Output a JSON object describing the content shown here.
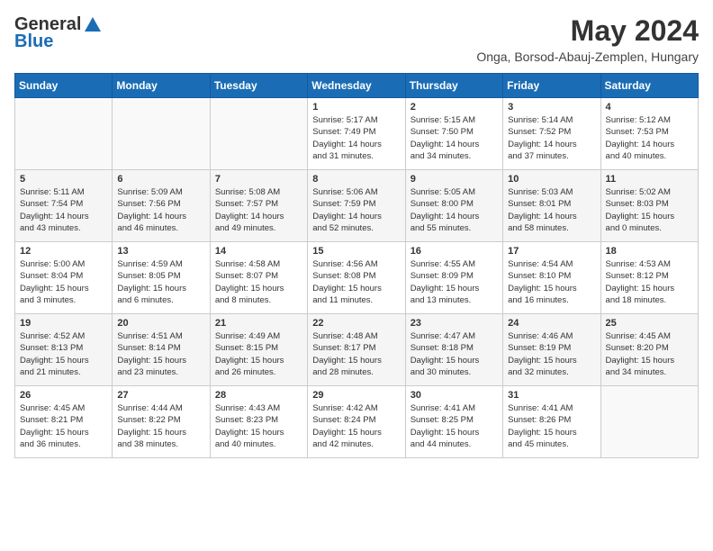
{
  "logo": {
    "general": "General",
    "blue": "Blue"
  },
  "title": "May 2024",
  "subtitle": "Onga, Borsod-Abauj-Zemplen, Hungary",
  "headers": [
    "Sunday",
    "Monday",
    "Tuesday",
    "Wednesday",
    "Thursday",
    "Friday",
    "Saturday"
  ],
  "weeks": [
    [
      {
        "day": "",
        "info": ""
      },
      {
        "day": "",
        "info": ""
      },
      {
        "day": "",
        "info": ""
      },
      {
        "day": "1",
        "info": "Sunrise: 5:17 AM\nSunset: 7:49 PM\nDaylight: 14 hours\nand 31 minutes."
      },
      {
        "day": "2",
        "info": "Sunrise: 5:15 AM\nSunset: 7:50 PM\nDaylight: 14 hours\nand 34 minutes."
      },
      {
        "day": "3",
        "info": "Sunrise: 5:14 AM\nSunset: 7:52 PM\nDaylight: 14 hours\nand 37 minutes."
      },
      {
        "day": "4",
        "info": "Sunrise: 5:12 AM\nSunset: 7:53 PM\nDaylight: 14 hours\nand 40 minutes."
      }
    ],
    [
      {
        "day": "5",
        "info": "Sunrise: 5:11 AM\nSunset: 7:54 PM\nDaylight: 14 hours\nand 43 minutes."
      },
      {
        "day": "6",
        "info": "Sunrise: 5:09 AM\nSunset: 7:56 PM\nDaylight: 14 hours\nand 46 minutes."
      },
      {
        "day": "7",
        "info": "Sunrise: 5:08 AM\nSunset: 7:57 PM\nDaylight: 14 hours\nand 49 minutes."
      },
      {
        "day": "8",
        "info": "Sunrise: 5:06 AM\nSunset: 7:59 PM\nDaylight: 14 hours\nand 52 minutes."
      },
      {
        "day": "9",
        "info": "Sunrise: 5:05 AM\nSunset: 8:00 PM\nDaylight: 14 hours\nand 55 minutes."
      },
      {
        "day": "10",
        "info": "Sunrise: 5:03 AM\nSunset: 8:01 PM\nDaylight: 14 hours\nand 58 minutes."
      },
      {
        "day": "11",
        "info": "Sunrise: 5:02 AM\nSunset: 8:03 PM\nDaylight: 15 hours\nand 0 minutes."
      }
    ],
    [
      {
        "day": "12",
        "info": "Sunrise: 5:00 AM\nSunset: 8:04 PM\nDaylight: 15 hours\nand 3 minutes."
      },
      {
        "day": "13",
        "info": "Sunrise: 4:59 AM\nSunset: 8:05 PM\nDaylight: 15 hours\nand 6 minutes."
      },
      {
        "day": "14",
        "info": "Sunrise: 4:58 AM\nSunset: 8:07 PM\nDaylight: 15 hours\nand 8 minutes."
      },
      {
        "day": "15",
        "info": "Sunrise: 4:56 AM\nSunset: 8:08 PM\nDaylight: 15 hours\nand 11 minutes."
      },
      {
        "day": "16",
        "info": "Sunrise: 4:55 AM\nSunset: 8:09 PM\nDaylight: 15 hours\nand 13 minutes."
      },
      {
        "day": "17",
        "info": "Sunrise: 4:54 AM\nSunset: 8:10 PM\nDaylight: 15 hours\nand 16 minutes."
      },
      {
        "day": "18",
        "info": "Sunrise: 4:53 AM\nSunset: 8:12 PM\nDaylight: 15 hours\nand 18 minutes."
      }
    ],
    [
      {
        "day": "19",
        "info": "Sunrise: 4:52 AM\nSunset: 8:13 PM\nDaylight: 15 hours\nand 21 minutes."
      },
      {
        "day": "20",
        "info": "Sunrise: 4:51 AM\nSunset: 8:14 PM\nDaylight: 15 hours\nand 23 minutes."
      },
      {
        "day": "21",
        "info": "Sunrise: 4:49 AM\nSunset: 8:15 PM\nDaylight: 15 hours\nand 26 minutes."
      },
      {
        "day": "22",
        "info": "Sunrise: 4:48 AM\nSunset: 8:17 PM\nDaylight: 15 hours\nand 28 minutes."
      },
      {
        "day": "23",
        "info": "Sunrise: 4:47 AM\nSunset: 8:18 PM\nDaylight: 15 hours\nand 30 minutes."
      },
      {
        "day": "24",
        "info": "Sunrise: 4:46 AM\nSunset: 8:19 PM\nDaylight: 15 hours\nand 32 minutes."
      },
      {
        "day": "25",
        "info": "Sunrise: 4:45 AM\nSunset: 8:20 PM\nDaylight: 15 hours\nand 34 minutes."
      }
    ],
    [
      {
        "day": "26",
        "info": "Sunrise: 4:45 AM\nSunset: 8:21 PM\nDaylight: 15 hours\nand 36 minutes."
      },
      {
        "day": "27",
        "info": "Sunrise: 4:44 AM\nSunset: 8:22 PM\nDaylight: 15 hours\nand 38 minutes."
      },
      {
        "day": "28",
        "info": "Sunrise: 4:43 AM\nSunset: 8:23 PM\nDaylight: 15 hours\nand 40 minutes."
      },
      {
        "day": "29",
        "info": "Sunrise: 4:42 AM\nSunset: 8:24 PM\nDaylight: 15 hours\nand 42 minutes."
      },
      {
        "day": "30",
        "info": "Sunrise: 4:41 AM\nSunset: 8:25 PM\nDaylight: 15 hours\nand 44 minutes."
      },
      {
        "day": "31",
        "info": "Sunrise: 4:41 AM\nSunset: 8:26 PM\nDaylight: 15 hours\nand 45 minutes."
      },
      {
        "day": "",
        "info": ""
      }
    ]
  ]
}
